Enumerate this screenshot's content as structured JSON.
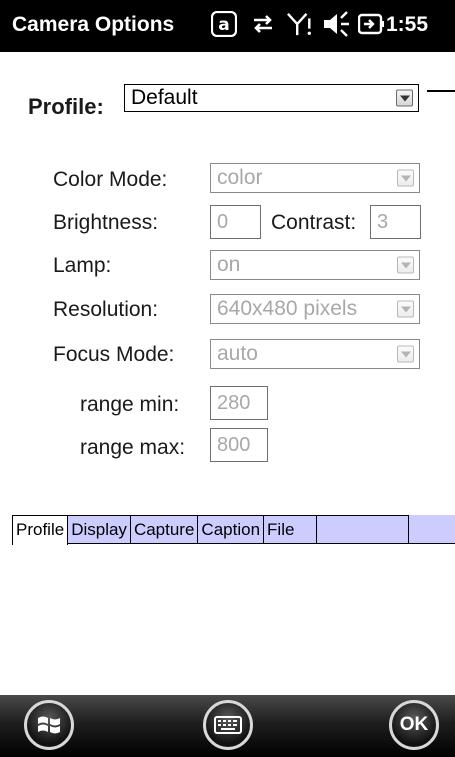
{
  "status_bar": {
    "app_title": "Camera Options",
    "time": "1:55",
    "icons": [
      "at-sign-icon",
      "data-sync-icon",
      "signal-icon",
      "speaker-icon",
      "battery-icon"
    ]
  },
  "profile": {
    "label": "Profile:",
    "value": "Default"
  },
  "fields": {
    "color_mode": {
      "label": "Color Mode:",
      "value": "color"
    },
    "brightness": {
      "label": "Brightness:",
      "value": "0"
    },
    "contrast": {
      "label": "Contrast:",
      "value": "3"
    },
    "lamp": {
      "label": "Lamp:",
      "value": "on"
    },
    "resolution": {
      "label": "Resolution:",
      "value": "640x480 pixels"
    },
    "focus_mode": {
      "label": "Focus Mode:",
      "value": "auto"
    },
    "range_min": {
      "label": "range min:",
      "value": "280"
    },
    "range_max": {
      "label": "range max:",
      "value": "800"
    }
  },
  "tabs": [
    "Profile",
    "Display",
    "Capture",
    "Caption",
    "File"
  ],
  "active_tab": "Profile",
  "bottom_bar": {
    "ok_label": "OK",
    "buttons": [
      "windows-start-icon",
      "keyboard-icon",
      "ok-button"
    ]
  },
  "colors": {
    "status_bar": "#000000",
    "tab_strip": "#ccccff",
    "disabled_text": "#a8a8a8"
  }
}
